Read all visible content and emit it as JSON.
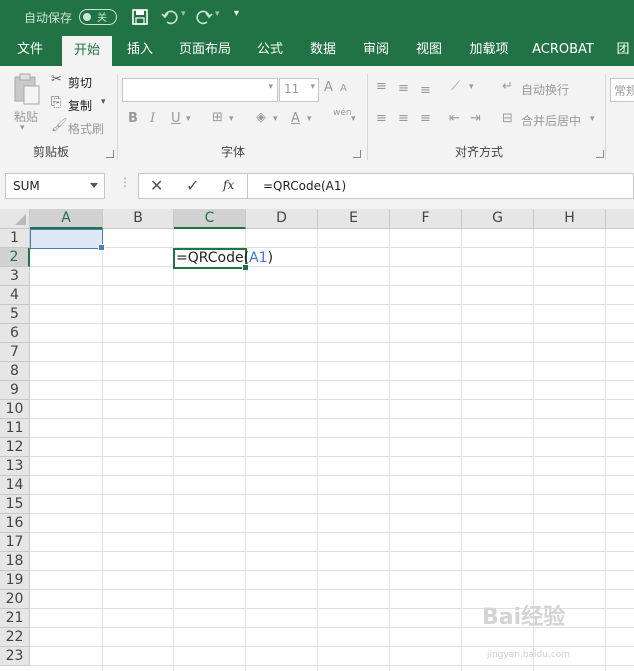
{
  "titlebar": {
    "autosave_label": "自动保存",
    "autosave_state": "关",
    "bg_color": "#217346"
  },
  "tabs": [
    "文件",
    "开始",
    "插入",
    "页面布局",
    "公式",
    "数据",
    "审阅",
    "视图",
    "加载项",
    "ACROBAT",
    "团"
  ],
  "active_tab": "开始",
  "ribbon": {
    "clipboard": {
      "paste": "粘贴",
      "cut": "剪切",
      "copy": "复制",
      "format_painter": "格式刷",
      "group_label": "剪贴板"
    },
    "font": {
      "font_name": "",
      "font_size": "11",
      "bold": "B",
      "italic": "I",
      "underline": "U",
      "phonetic": "wén",
      "group_label": "字体"
    },
    "alignment": {
      "wrap_text": "自动换行",
      "merge_center": "合并后居中",
      "group_label": "对齐方式"
    },
    "number": {
      "format": "常规"
    }
  },
  "formula_bar": {
    "name_box": "SUM",
    "fx": "fx",
    "formula": "=QRCode(A1)"
  },
  "columns": [
    "A",
    "B",
    "C",
    "D",
    "E",
    "F",
    "G",
    "H"
  ],
  "rows": [
    "1",
    "2",
    "3",
    "4",
    "5",
    "6",
    "7",
    "8",
    "9",
    "10",
    "11",
    "12",
    "13",
    "14",
    "15",
    "16",
    "17",
    "18",
    "19",
    "20",
    "21",
    "22",
    "23"
  ],
  "active_cell": {
    "ref": "C2",
    "edit_prefix": "=QRCode(",
    "edit_ref": "A1",
    "edit_suffix": ")"
  },
  "watermark": {
    "text": "Bai经验",
    "url": "jingyan.baidu.com"
  }
}
